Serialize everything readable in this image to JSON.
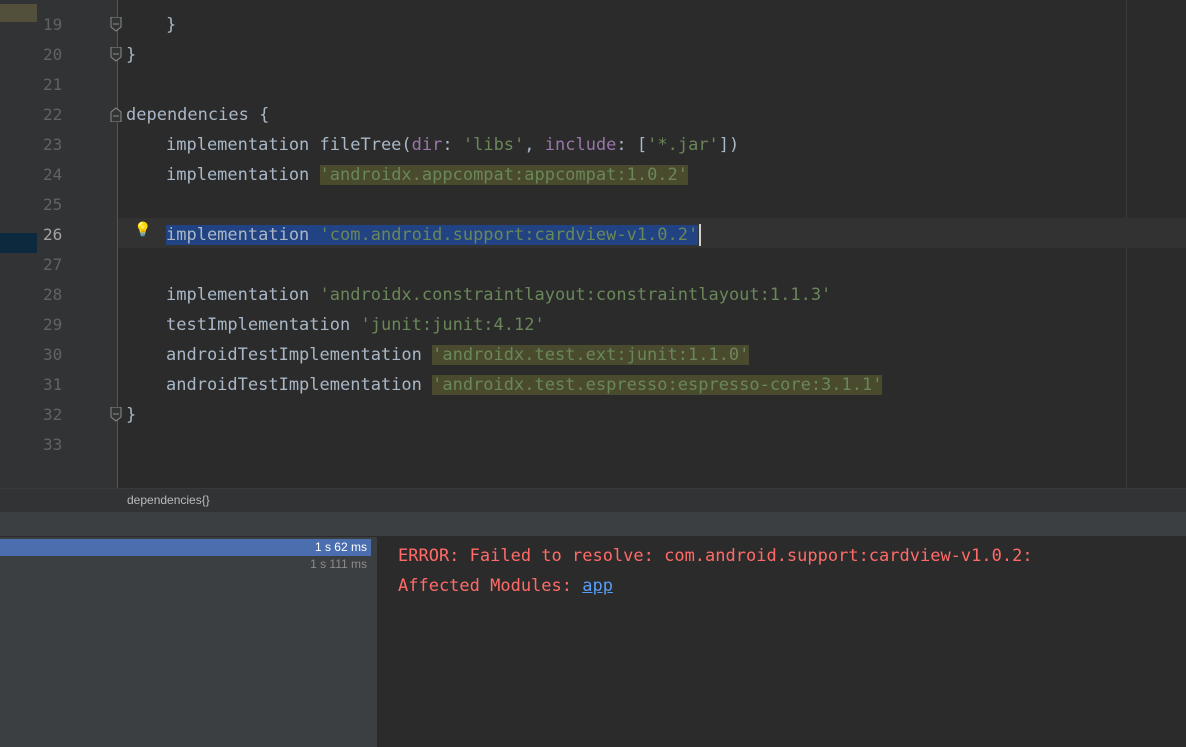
{
  "editor": {
    "lines": [
      {
        "num": "19",
        "text": "}"
      },
      {
        "num": "20",
        "text": "}"
      },
      {
        "num": "21",
        "text": ""
      },
      {
        "num": "22",
        "name": "dependencies",
        "brace": " {"
      },
      {
        "num": "23",
        "kw": "implementation",
        "fn": " fileTree(",
        "arg1": "dir",
        "colon1": ": ",
        "str1": "'libs'",
        "comma": ", ",
        "arg2": "include",
        "colon2": ": [",
        "str2": "'*.jar'",
        "end": "])"
      },
      {
        "num": "24",
        "kw": "implementation",
        "str": "'androidx.appcompat:appcompat:1.0.2'"
      },
      {
        "num": "25",
        "text": ""
      },
      {
        "num": "26",
        "kw": "implementation",
        "str": "'com.android.support:cardview-v1.0.2'"
      },
      {
        "num": "27",
        "text": ""
      },
      {
        "num": "28",
        "kw": "implementation",
        "str": "'androidx.constraintlayout:constraintlayout:1.1.3'"
      },
      {
        "num": "29",
        "kw": "testImplementation",
        "str": "'junit:junit:4.12'"
      },
      {
        "num": "30",
        "kw": "androidTestImplementation",
        "str": "'androidx.test.ext:junit:1.1.0'"
      },
      {
        "num": "31",
        "kw": "androidTestImplementation",
        "str": "'androidx.test.espresso:espresso-core:3.1.1'"
      },
      {
        "num": "32",
        "text": "}"
      },
      {
        "num": "33",
        "text": ""
      }
    ],
    "breadcrumb": "dependencies{}"
  },
  "build": {
    "timings": [
      "1 s 62 ms",
      "1 s 111 ms"
    ]
  },
  "console": {
    "error": "ERROR: Failed to resolve: com.android.support:cardview-v1.0.2:",
    "affected_label": "Affected Modules: ",
    "module_link": "app"
  },
  "colors": {
    "error": "#ff6b68",
    "link": "#589df6",
    "selection": "#214283",
    "string": "#6a8759"
  }
}
